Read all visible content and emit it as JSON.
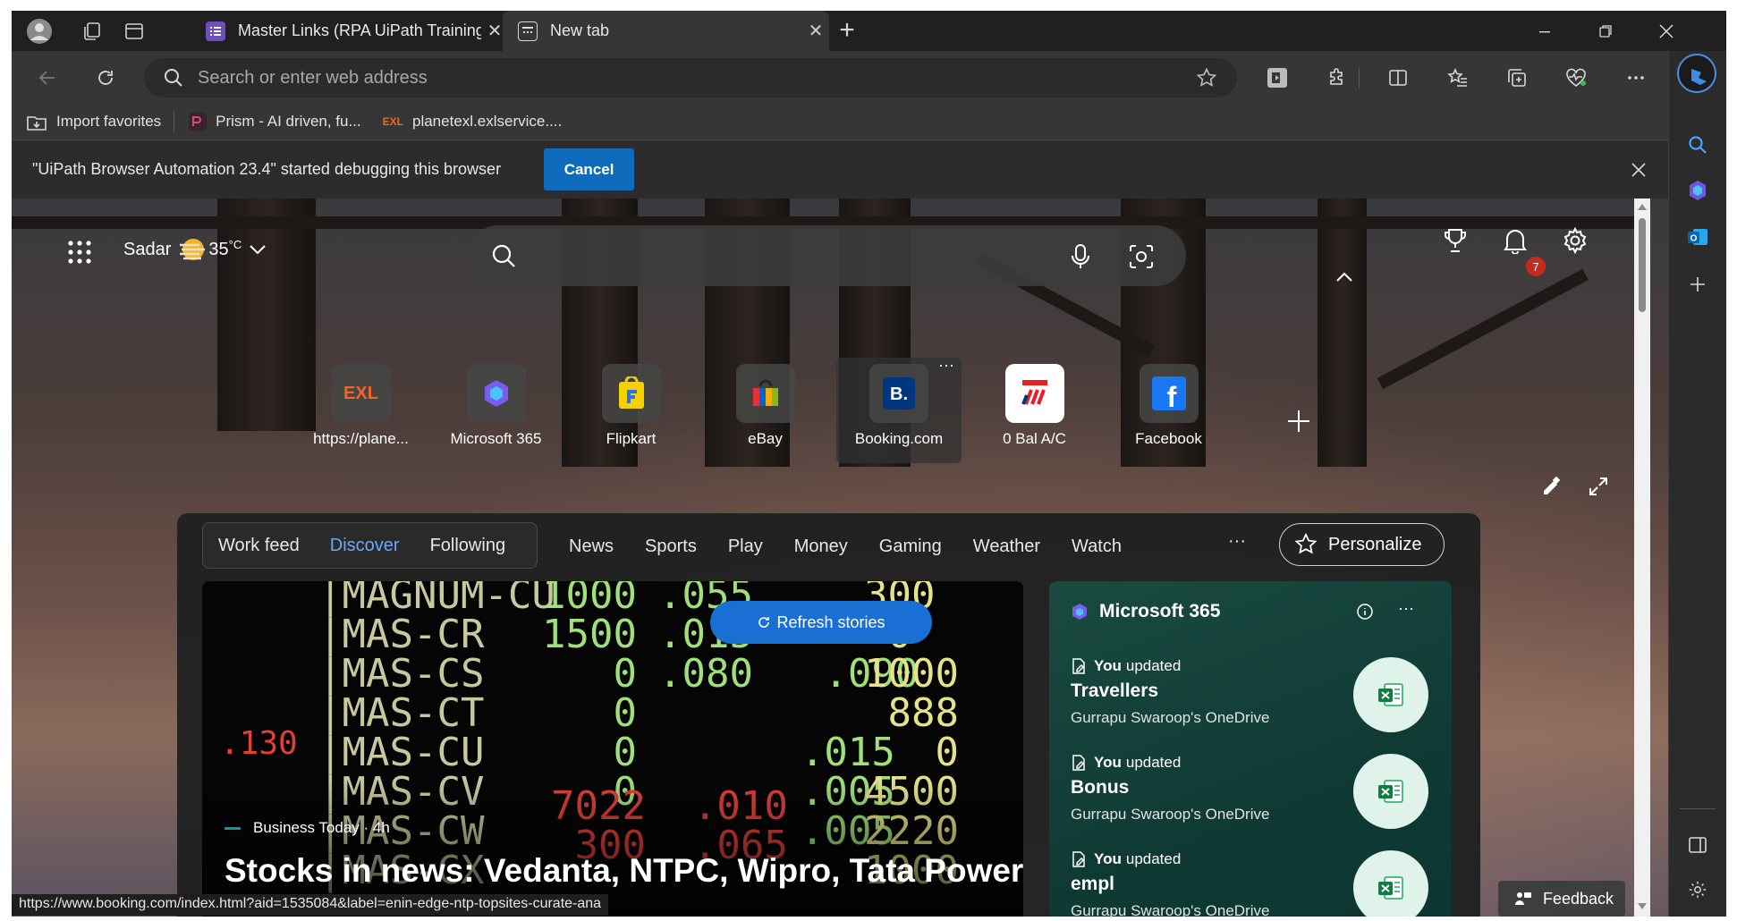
{
  "tabs": [
    {
      "title": "Master Links (RPA UiPath Training",
      "active": false
    },
    {
      "title": "New tab",
      "active": true
    }
  ],
  "omnibox": {
    "placeholder": "Search or enter web address"
  },
  "favorites": [
    {
      "label": "Import favorites"
    },
    {
      "label": "Prism - AI driven, fu..."
    },
    {
      "label": "planetexl.exlservice...."
    }
  ],
  "favorites_exl_logo": "EXL",
  "debug_bar": {
    "message": "\"UiPath Browser Automation 23.4\" started debugging this browser",
    "cancel_label": "Cancel"
  },
  "weather": {
    "location": "Sadar",
    "temperature": "35",
    "unit": "°C"
  },
  "notifications": {
    "count": "7"
  },
  "quick_links": [
    {
      "label": "https://plane...",
      "icon_text": "EXL",
      "color": "#f26522"
    },
    {
      "label": "Microsoft 365",
      "icon_text": "",
      "color": "#6b8cff"
    },
    {
      "label": "Flipkart",
      "icon_text": "",
      "color": "#f7d000"
    },
    {
      "label": "eBay",
      "icon_text": "",
      "color": "#e53238"
    },
    {
      "label": "Booking.com",
      "icon_text": "B.",
      "color": "#003580"
    },
    {
      "label": "0 Bal A/C",
      "icon_text": "",
      "color": "#ed1c24"
    },
    {
      "label": "Facebook",
      "icon_text": "f",
      "color": "#1877f2"
    }
  ],
  "feed": {
    "segments": [
      "Work feed",
      "Discover",
      "Following"
    ],
    "selected_segment": "Discover",
    "nav": [
      "News",
      "Sports",
      "Play",
      "Money",
      "Gaming",
      "Weather",
      "Watch"
    ],
    "more": "···",
    "personalize": "Personalize",
    "refresh": "Refresh stories",
    "hero": {
      "source": "Business Today · 4h",
      "headline": "Stocks in news: Vedanta, NTPC, Wipro, Tata Power,"
    }
  },
  "m365": {
    "title": "Microsoft 365",
    "docs": [
      {
        "you": "You",
        "action": "updated",
        "name": "Travellers",
        "location": "Gurrapu Swaroop's OneDrive"
      },
      {
        "you": "You",
        "action": "updated",
        "name": "Bonus",
        "location": "Gurrapu Swaroop's OneDrive"
      },
      {
        "you": "You",
        "action": "updated",
        "name": "empl",
        "location": "Gurrapu Swaroop's OneDrive"
      }
    ]
  },
  "status_url": "https://www.booking.com/index.html?aid=1535084&label=enin-edge-ntp-topsites-curate-ana",
  "feedback": "Feedback"
}
